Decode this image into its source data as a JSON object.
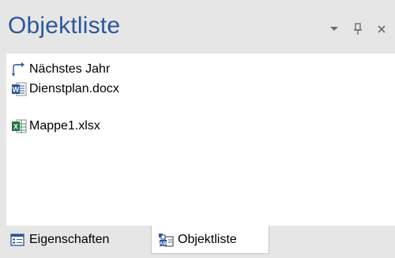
{
  "panel": {
    "title": "Objektliste",
    "controls": [
      {
        "icon": "chevron-down-icon"
      },
      {
        "icon": "pin-icon"
      },
      {
        "icon": "close-icon"
      }
    ]
  },
  "items": [
    {
      "label": "Nächstes Jahr",
      "icon": "recurrence-arrow-icon"
    },
    {
      "label": "Dienstplan.docx",
      "icon": "word-document-icon"
    },
    {
      "label": "Mappe1.xlsx",
      "icon": "excel-workbook-icon"
    }
  ],
  "tabs": [
    {
      "label": "Eigenschaften",
      "icon": "properties-icon",
      "active": false
    },
    {
      "label": "Objektliste",
      "icon": "object-list-icon",
      "active": true
    }
  ],
  "colors": {
    "title": "#2b579a",
    "panel_bg": "#e6e6e6",
    "word_blue": "#2b579a",
    "excel_green": "#217346"
  }
}
